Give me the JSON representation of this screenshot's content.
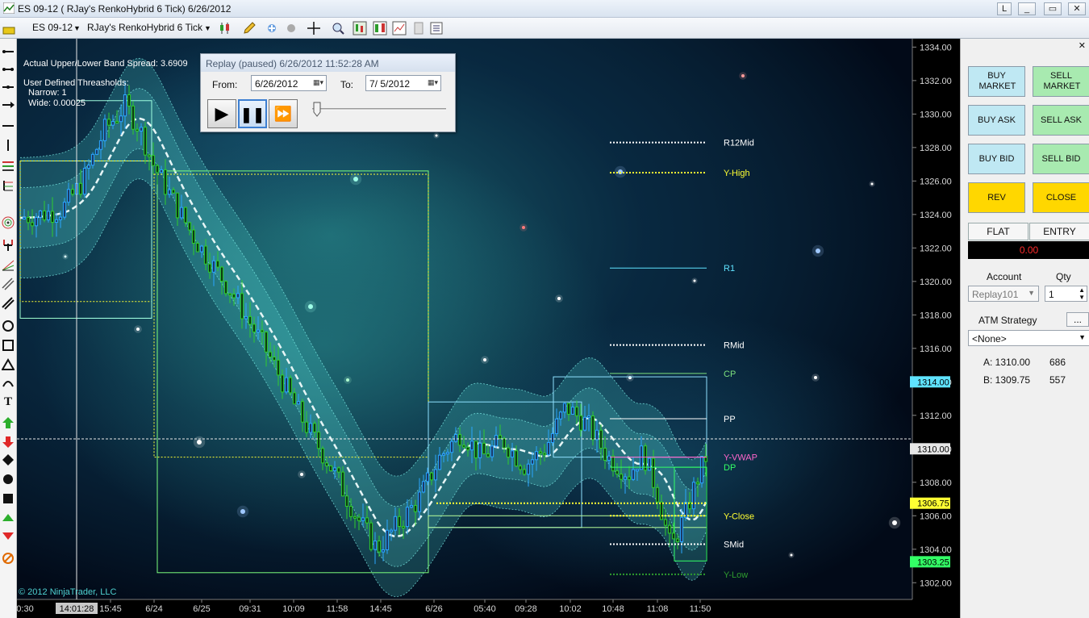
{
  "window": {
    "title": "ES 09-12 ( RJay's RenkoHybrid  6 Tick)  6/26/2012",
    "buttons": [
      "L",
      "_",
      "▭",
      "✕"
    ]
  },
  "toolbar": {
    "instrument": "ES 09-12",
    "bar_type": "RJay's RenkoHybrid  6 Tick"
  },
  "chart": {
    "info_lines": [
      "Actual Upper/Lower Band Spread: 3.6909",
      "User Defined Threasholds:",
      "Narrow: 1",
      "Wide: 0.00025"
    ],
    "copyright": "© 2012 NinjaTrader, LLC",
    "crosshair_time": "14:01:28",
    "colors": {
      "up_bar": "#2aa6ff",
      "down_bar": "#2ecc2e",
      "band": "#5fe3e0",
      "vwap": "#ff66cc",
      "yellow": "#ffff33"
    }
  },
  "chart_data": {
    "type": "line",
    "x_ticks": [
      "0:30",
      "15:45",
      "6/24",
      "6/25",
      "09:31",
      "10:09",
      "11:58",
      "14:45",
      "6/26",
      "05:40",
      "09:28",
      "10:02",
      "10:48",
      "11:08",
      "11:50"
    ],
    "y_ticks": [
      1334.0,
      1332.0,
      1330.0,
      1328.0,
      1326.0,
      1324.0,
      1322.0,
      1320.0,
      1318.0,
      1316.0,
      1314.0,
      1312.0,
      1310.0,
      1308.0,
      1306.0,
      1304.0,
      1302.0
    ],
    "ylim": [
      1301.0,
      1334.5
    ],
    "price_markers": [
      {
        "label": "1314.00",
        "value": 1314.0,
        "color": "#5fe3ff"
      },
      {
        "label": "1310.00",
        "value": 1310.0,
        "color": "#e6e6e6"
      },
      {
        "label": "1306.75",
        "value": 1306.75,
        "color": "#ffff33"
      },
      {
        "label": "1303.25",
        "value": 1303.25,
        "color": "#33ff66"
      }
    ],
    "levels": [
      {
        "name": "R12Mid",
        "value": 1328.3,
        "color": "#ffffff",
        "dash": "2,2"
      },
      {
        "name": "Y-High",
        "value": 1326.5,
        "color": "#ffff33",
        "dash": "2,2"
      },
      {
        "name": "R1",
        "value": 1320.8,
        "color": "#5fe3ff",
        "dash": ""
      },
      {
        "name": "RMid",
        "value": 1316.2,
        "color": "#ffffff",
        "dash": "2,2"
      },
      {
        "name": "CP",
        "value": 1314.5,
        "color": "#7de07d",
        "dash": ""
      },
      {
        "name": "PP",
        "value": 1311.8,
        "color": "#ffffff",
        "dash": ""
      },
      {
        "name": "Y-VWAP",
        "value": 1309.5,
        "color": "#ff66cc",
        "dash": ""
      },
      {
        "name": "DP",
        "value": 1308.9,
        "color": "#33ff66",
        "dash": ""
      },
      {
        "name": "Y-Close",
        "value": 1306.0,
        "color": "#ffff33",
        "dash": "2,2"
      },
      {
        "name": "SMid",
        "value": 1304.3,
        "color": "#ffffff",
        "dash": "2,2"
      },
      {
        "name": "Y-Low",
        "value": 1302.5,
        "color": "#2e9c2e",
        "dash": "2,2"
      }
    ],
    "price_path": [
      {
        "t": 0,
        "p": 1323.8
      },
      {
        "t": 3,
        "p": 1324.0
      },
      {
        "t": 6,
        "p": 1324.3
      },
      {
        "t": 9,
        "p": 1326.0
      },
      {
        "t": 12,
        "p": 1329.0
      },
      {
        "t": 15,
        "p": 1330.5
      },
      {
        "t": 17,
        "p": 1329.2
      },
      {
        "t": 19,
        "p": 1327.0
      },
      {
        "t": 21,
        "p": 1325.5
      },
      {
        "t": 25,
        "p": 1322.5
      },
      {
        "t": 30,
        "p": 1319.5
      },
      {
        "t": 35,
        "p": 1316.0
      },
      {
        "t": 40,
        "p": 1312.0
      },
      {
        "t": 45,
        "p": 1308.5
      },
      {
        "t": 48,
        "p": 1306.0
      },
      {
        "t": 51,
        "p": 1304.0
      },
      {
        "t": 54,
        "p": 1305.5
      },
      {
        "t": 57,
        "p": 1307.0
      },
      {
        "t": 60,
        "p": 1309.5
      },
      {
        "t": 63,
        "p": 1311.0
      },
      {
        "t": 66,
        "p": 1309.5
      },
      {
        "t": 69,
        "p": 1310.5
      },
      {
        "t": 72,
        "p": 1309.0
      },
      {
        "t": 75,
        "p": 1310.0
      },
      {
        "t": 78,
        "p": 1312.5
      },
      {
        "t": 81,
        "p": 1311.5
      },
      {
        "t": 84,
        "p": 1309.5
      },
      {
        "t": 87,
        "p": 1308.5
      },
      {
        "t": 89,
        "p": 1309.8
      },
      {
        "t": 91,
        "p": 1307.5
      },
      {
        "t": 93,
        "p": 1304.0
      },
      {
        "t": 95,
        "p": 1306.0
      },
      {
        "t": 97,
        "p": 1308.5
      },
      {
        "t": 98,
        "p": 1309.5
      }
    ]
  },
  "replay": {
    "title": "Replay (paused) 6/26/2012 11:52:28 AM",
    "from_label": "From:",
    "from_value": "6/26/2012",
    "to_label": "To:",
    "to_value": "7/ 5/2012",
    "play": "▶",
    "pause": "❚❚",
    "fast_forward": "⏩"
  },
  "order_panel": {
    "buy_market": "BUY MARKET",
    "sell_market": "SELL MARKET",
    "buy_ask": "BUY ASK",
    "sell_ask": "SELL ASK",
    "buy_bid": "BUY BID",
    "sell_bid": "SELL BID",
    "rev": "REV",
    "close": "CLOSE",
    "flat": "FLAT",
    "entry": "ENTRY",
    "pnl": "0.00",
    "account_label": "Account",
    "account_value": "Replay101",
    "qty_label": "Qty",
    "qty_value": "1",
    "atm_label": "ATM Strategy",
    "atm_button": "...",
    "atm_value": "<None>",
    "ask_label": "A: 1310.00",
    "ask_size": "686",
    "bid_label": "B: 1309.75",
    "bid_size": "557"
  }
}
